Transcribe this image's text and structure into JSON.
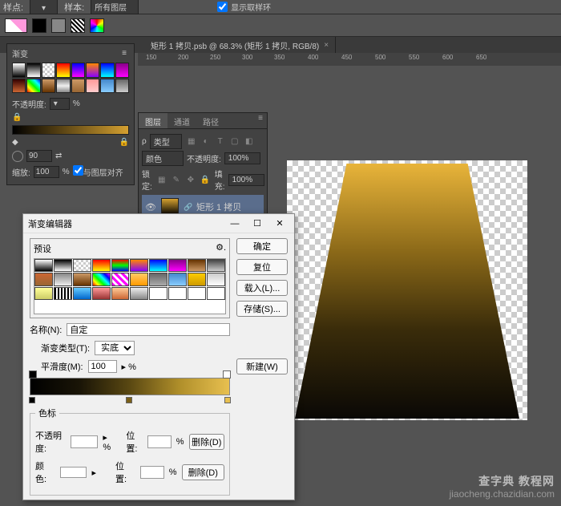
{
  "topbar": {
    "sample_point_label": "样点:",
    "sample_label": "样本:",
    "sample_value": "所有图层",
    "show_sample_ring": "显示取样环"
  },
  "doc_tab": {
    "title": "矩形 1 拷贝.psb @ 68.3% (矩形 1 拷贝, RGB/8)"
  },
  "ruler_marks": [
    "150",
    "200",
    "250",
    "300",
    "350",
    "400",
    "450",
    "500",
    "550",
    "600",
    "650"
  ],
  "gradient_panel": {
    "title": "渐变",
    "opacity_label": "不透明度:",
    "angle_value": "90",
    "zoom_label": "缩放:",
    "zoom_value": "100",
    "align_label": "与图层对齐"
  },
  "layers_panel": {
    "tabs": [
      "图层",
      "通道",
      "路径"
    ],
    "kind_label": "类型",
    "blend_label": "颜色",
    "opacity_label": "不透明度:",
    "opacity_value": "100%",
    "lock_label": "锁定:",
    "fill_label": "填充:",
    "fill_value": "100%",
    "layer_name": "矩形 1 拷贝"
  },
  "dialog": {
    "title": "渐变编辑器",
    "preset_label": "预设",
    "ok": "确定",
    "cancel": "复位",
    "load": "载入(L)...",
    "save": "存储(S)...",
    "name_label": "名称(N):",
    "name_value": "自定",
    "new_btn": "新建(W)",
    "type_label": "渐变类型(T):",
    "type_value": "实底",
    "smooth_label": "平滑度(M):",
    "smooth_value": "100",
    "stops_label": "色标",
    "stop_opacity_label": "不透明度:",
    "stop_pos_label": "位置:",
    "stop_delete": "删除(D)",
    "stop_color_label": "颜色:"
  },
  "watermark": {
    "big": "查字典 教程网",
    "small": "jiaocheng.chazidian.com"
  },
  "chart_data": {
    "type": "gradient",
    "direction": "vertical",
    "stops": [
      {
        "pos": 0,
        "color": "#e8b43a"
      },
      {
        "pos": 100,
        "color": "#000000"
      }
    ],
    "shape": "trapezoid"
  }
}
